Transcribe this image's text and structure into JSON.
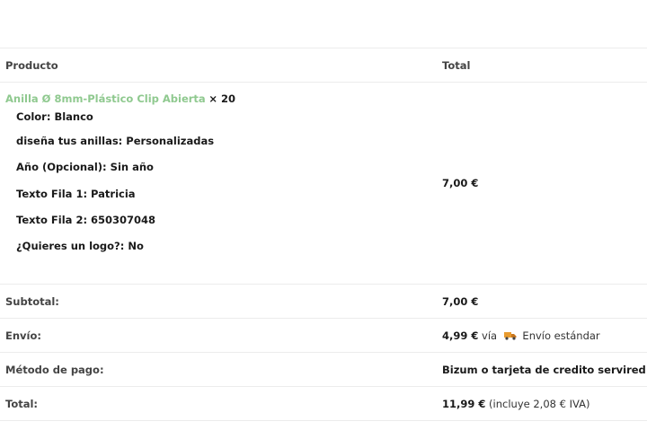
{
  "table": {
    "header": {
      "product": "Producto",
      "total": "Total"
    },
    "item": {
      "name": "Anilla Ø 8mm-Plástico Clip Abierta",
      "qty": "× 20",
      "meta": [
        "Color: Blanco",
        "diseña tus anillas: Personalizadas",
        "Año (Opcional): Sin año",
        "Texto Fila 1: Patricia",
        "Texto Fila 2: 650307048",
        "¿Quieres un logo?: No"
      ],
      "total": "7,00 €"
    },
    "subtotal": {
      "label": "Subtotal:",
      "value": "7,00 €"
    },
    "shipping": {
      "label": "Envío:",
      "amount": "4,99 €",
      "via": "vía",
      "method": "Envío estándar",
      "icon": "truck-icon"
    },
    "payment": {
      "label": "Método de pago:",
      "value": "Bizum o tarjeta de credito servired"
    },
    "total": {
      "label": "Total:",
      "amount": "11,99 €",
      "tax_note": "(incluye 2,08 € IVA)"
    }
  },
  "colors": {
    "link": "#8fc98f",
    "border": "#ececec",
    "truck": "#e89b2f"
  }
}
